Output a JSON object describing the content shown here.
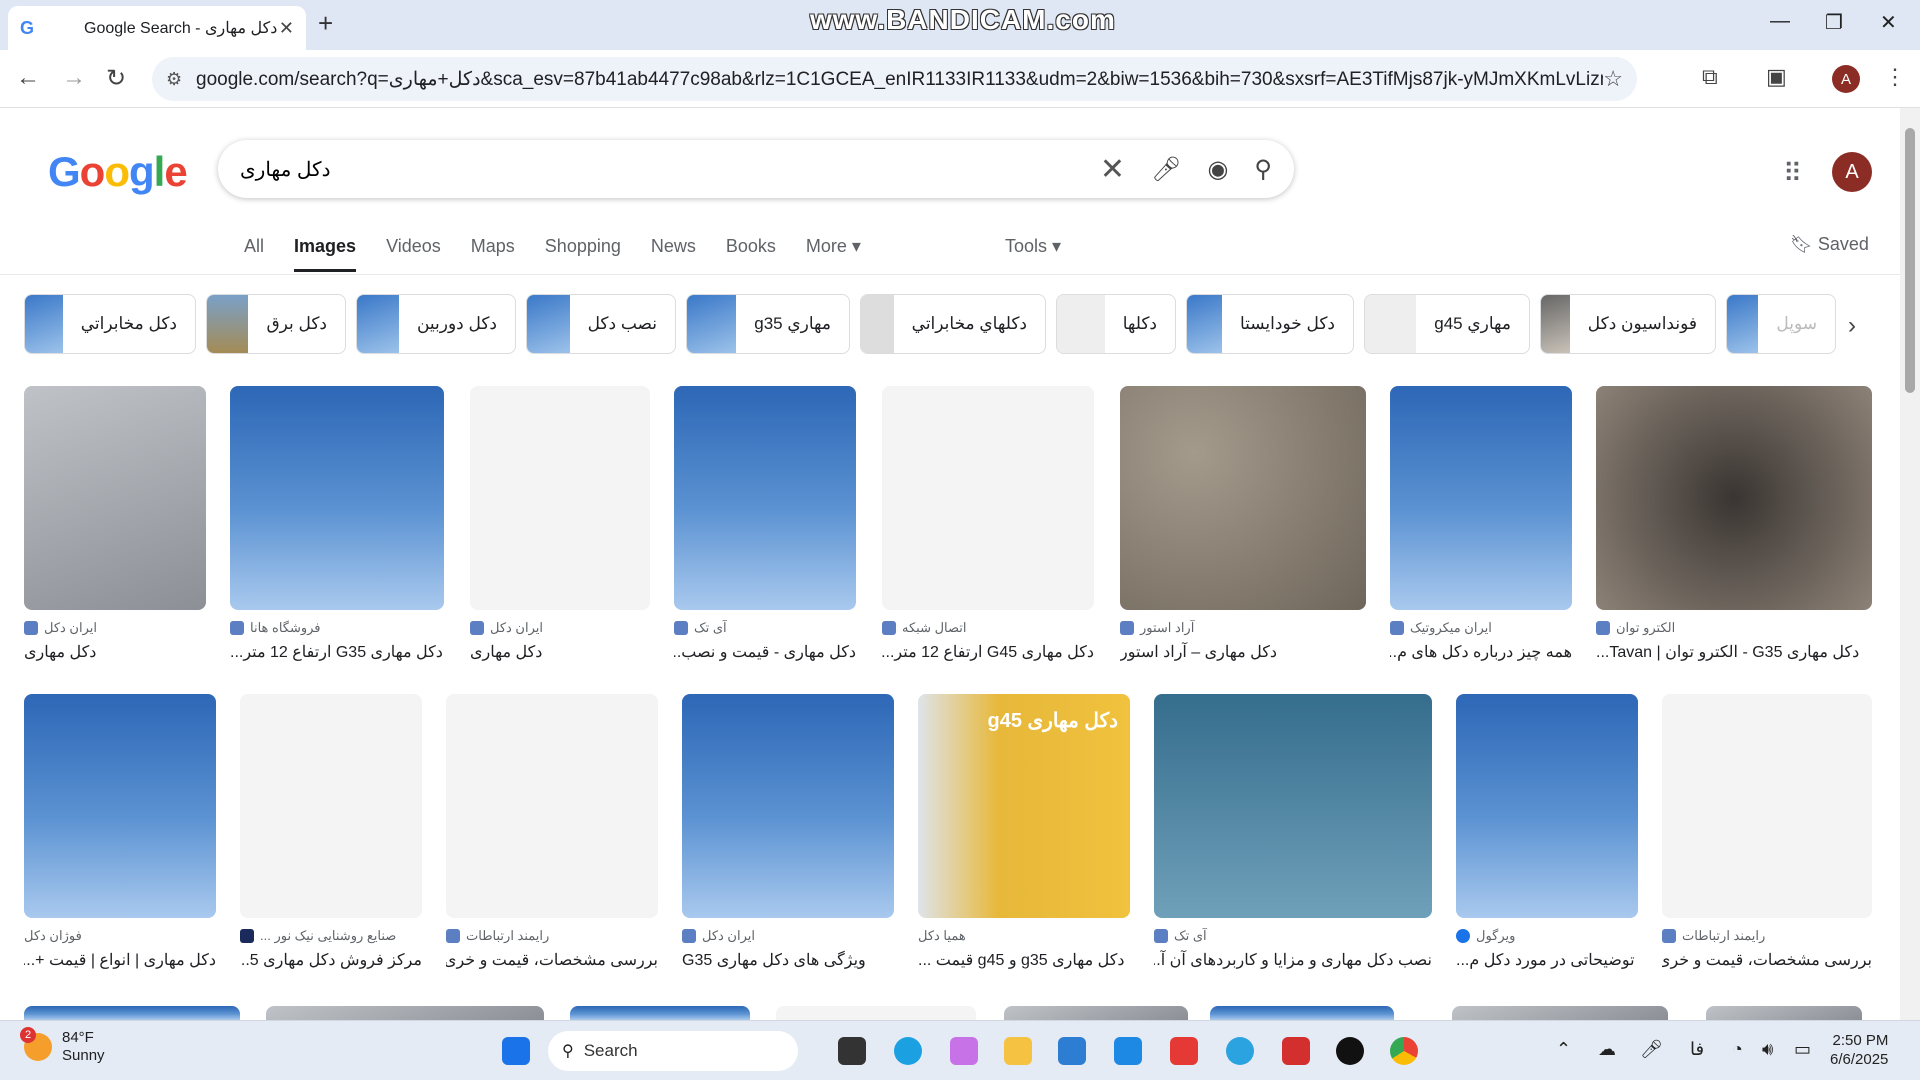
{
  "browser": {
    "tab_title": "Google Search - دکل مهاری",
    "url": "google.com/search?q=دکل+مهاری&sca_esv=87b41ab4477c98ab&rlz=1C1GCEA_enIR1133IR1133&udm=2&biw=1536&bih=730&sxsrf=AE3TifMjs87jk-yMJmXKmLvLizmZjWl7Aw%3A17...",
    "profile_initial": "A",
    "watermark": "www.BANDICAM.com"
  },
  "google": {
    "logo": "Google",
    "query": "دکل مهاری",
    "profile_initial": "A",
    "tabs": [
      "All",
      "Images",
      "Videos",
      "Maps",
      "Shopping",
      "News",
      "Books",
      "More ▾"
    ],
    "tools_label": "Tools ▾",
    "saved_label": "Saved",
    "chips": [
      "دکل مخابراتي",
      "دکل برق",
      "دکل دوربین",
      "نصب دکل",
      "مهاري g35",
      "دکلهاي مخابراتي",
      "دکلها",
      "دکل خودايستا",
      "مهاري g45",
      "فونداسیون دکل",
      "سوپل"
    ]
  },
  "results_row1": [
    {
      "source": "ایران دکل",
      "caption": "دکل مهاری"
    },
    {
      "source": "فروشگاه هانا",
      "caption": "دکل مهاری G35 ارتفاع 12 متر..."
    },
    {
      "source": "ایران دکل",
      "caption": "دکل مهاری"
    },
    {
      "source": "آی تک",
      "caption": "دکل مهاری - قیمت و نصب..."
    },
    {
      "source": "اتصال شبکه",
      "caption": "دکل مهاری G45 ارتفاع 12 متر..."
    },
    {
      "source": "آراد استور",
      "caption": "دکل مهاری – آراد استور"
    },
    {
      "source": "ایران میکروتیک",
      "caption": "همه چیز درباره دکل های م..."
    },
    {
      "source": "الکترو توان",
      "caption": "دکل مهاری G35 - الکترو توان | Tavan..."
    }
  ],
  "results_row2": [
    {
      "source": "فوژان دکل",
      "caption": "دکل مهاری | انواع | قیمت +..."
    },
    {
      "source": "صنایع روشنایی نیک نور ...",
      "caption": "مرکز فروش دکل مهاری 5..."
    },
    {
      "source": "رایمند ارتباطات",
      "caption": "بررسی مشخصات، قیمت و خری..."
    },
    {
      "source": "ایران دکل",
      "caption": "ویژگی های دکل مهاری G35"
    },
    {
      "source": "همیا دکل",
      "caption": "دکل مهاری g35 و g45 قیمت ..."
    },
    {
      "source": "آی تک",
      "caption": "نصب دکل مهاری و مزایا و کاربردهای آن آ..."
    },
    {
      "source": "ویرگول",
      "caption": "توضیحاتی در مورد دکل م..."
    },
    {
      "source": "رایمند ارتباطات",
      "caption": "بررسی مشخصات، قیمت و خری..."
    }
  ],
  "promo_text": "دکل مهاری g45",
  "taskbar": {
    "temp": "84°F",
    "condition": "Sunny",
    "badge": "2",
    "search_label": "Search",
    "lang": "فا",
    "time": "2:50 PM",
    "date": "6/6/2025"
  }
}
